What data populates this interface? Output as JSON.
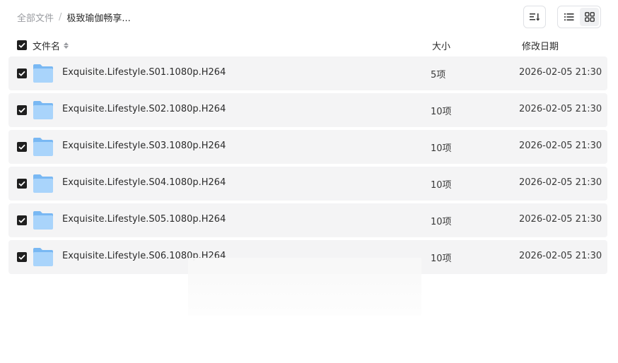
{
  "breadcrumb": {
    "root": "全部文件",
    "separator": "/",
    "current": "极致瑜伽畅享..."
  },
  "toolbar": {
    "sort_icon": "sort-icon",
    "view_list_icon": "list-view-icon",
    "view_grid_icon": "grid-view-icon",
    "active_view": "grid"
  },
  "table": {
    "columns": {
      "name": "文件名",
      "size": "大小",
      "date": "修改日期"
    },
    "rows": [
      {
        "name": "Exquisite.Lifestyle.S01.1080p.H264",
        "size": "5项",
        "date": "2026-02-05 21:30",
        "checked": true
      },
      {
        "name": "Exquisite.Lifestyle.S02.1080p.H264",
        "size": "10项",
        "date": "2026-02-05 21:30",
        "checked": true
      },
      {
        "name": "Exquisite.Lifestyle.S03.1080p.H264",
        "size": "10项",
        "date": "2026-02-05 21:30",
        "checked": true
      },
      {
        "name": "Exquisite.Lifestyle.S04.1080p.H264",
        "size": "10项",
        "date": "2026-02-05 21:30",
        "checked": true
      },
      {
        "name": "Exquisite.Lifestyle.S05.1080p.H264",
        "size": "10项",
        "date": "2026-02-05 21:30",
        "checked": true
      },
      {
        "name": "Exquisite.Lifestyle.S06.1080p.H264",
        "size": "10项",
        "date": "2026-02-05 21:30",
        "checked": true
      }
    ]
  },
  "colors": {
    "row_bg": "#f4f4f5",
    "checkbox": "#1f1f1f",
    "folder_light": "#a9d4fb",
    "folder_dark": "#79b8f3"
  }
}
